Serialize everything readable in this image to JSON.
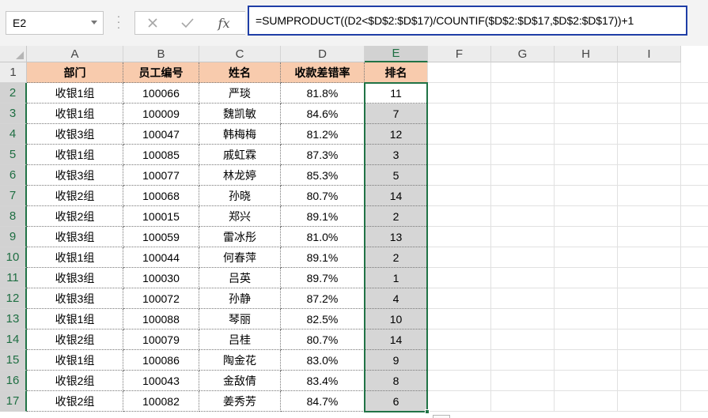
{
  "namebox": {
    "value": "E2"
  },
  "formula_bar": {
    "cancel_icon": "close-icon",
    "enter_icon": "check-icon",
    "fx_label": "fx",
    "formula": "=SUMPRODUCT((D2<$D$2:$D$17)/COUNTIF($D$2:$D$17,$D$2:$D$17))+1"
  },
  "columns": [
    "A",
    "B",
    "C",
    "D",
    "E",
    "F",
    "G",
    "H",
    "I"
  ],
  "rows": [
    "1",
    "2",
    "3",
    "4",
    "5",
    "6",
    "7",
    "8",
    "9",
    "10",
    "11",
    "12",
    "13",
    "14",
    "15",
    "16",
    "17"
  ],
  "headers": [
    "部门",
    "员工编号",
    "姓名",
    "收款差错率",
    "排名"
  ],
  "data": [
    [
      "收银1组",
      "100066",
      "严琰",
      "81.8%",
      "11"
    ],
    [
      "收银1组",
      "100009",
      "魏凯敏",
      "84.6%",
      "7"
    ],
    [
      "收银3组",
      "100047",
      "韩梅梅",
      "81.2%",
      "12"
    ],
    [
      "收银1组",
      "100085",
      "戚虹霖",
      "87.3%",
      "3"
    ],
    [
      "收银3组",
      "100077",
      "林龙婷",
      "85.3%",
      "5"
    ],
    [
      "收银2组",
      "100068",
      "孙晓",
      "80.7%",
      "14"
    ],
    [
      "收银2组",
      "100015",
      "郑兴",
      "89.1%",
      "2"
    ],
    [
      "收银3组",
      "100059",
      "雷冰彤",
      "81.0%",
      "13"
    ],
    [
      "收银1组",
      "100044",
      "何春萍",
      "89.1%",
      "2"
    ],
    [
      "收银3组",
      "100030",
      "吕英",
      "89.7%",
      "1"
    ],
    [
      "收银3组",
      "100072",
      "孙静",
      "87.2%",
      "4"
    ],
    [
      "收银1组",
      "100088",
      "琴丽",
      "82.5%",
      "10"
    ],
    [
      "收银2组",
      "100079",
      "吕桂",
      "80.7%",
      "14"
    ],
    [
      "收银1组",
      "100086",
      "陶金花",
      "83.0%",
      "9"
    ],
    [
      "收银2组",
      "100043",
      "金敌倩",
      "83.4%",
      "8"
    ],
    [
      "收银2组",
      "100082",
      "姜秀芳",
      "84.7%",
      "6"
    ]
  ],
  "colors": {
    "header_fill": "#f8cbad",
    "selection": "#217346",
    "selected_range_fill": "#d6d6d6",
    "formula_border": "#1f3ea6"
  }
}
